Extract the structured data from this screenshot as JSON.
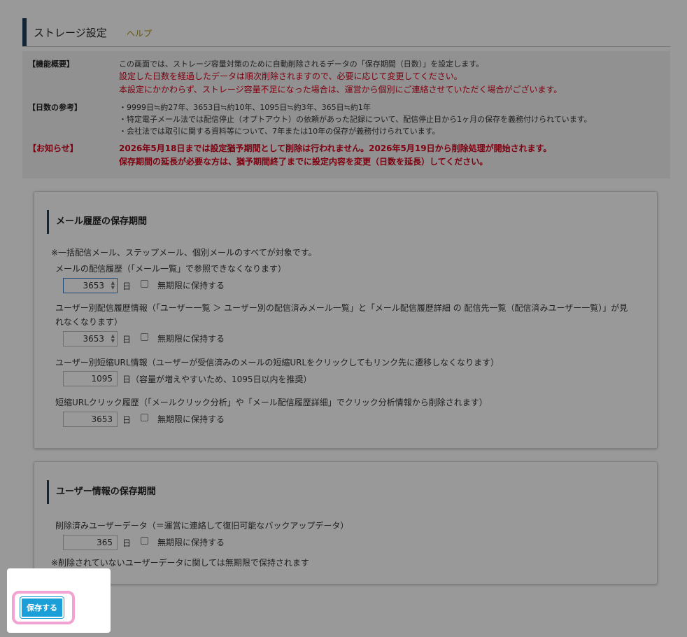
{
  "header": {
    "title": "ストレージ設定",
    "help_link": "ヘルプ"
  },
  "info": {
    "overview_label": "【機能概要】",
    "overview_lines": [
      "この画面では、ストレージ容量対策のために自動削除されるデータの「保存期間（日数）」を設定します。",
      "設定した日数を経過したデータは順次削除されますので、必要に応じて変更してください。",
      "本設定にかかわらず、ストレージ容量不足になった場合は、運営から個別にご連絡させていただく場合がございます。"
    ],
    "reference_label": "【日数の参考】",
    "reference_lines": [
      "・9999日≒約27年、3653日≒約10年、1095日≒約3年、365日≒約1年",
      "・特定電子メール法では配信停止（オプトアウト）の依頼があった記録について、配信停止日から1ヶ月の保存を義務付けられています。",
      "・会社法では取引に関する資料等について、7年または10年の保存が義務付けられています。"
    ],
    "notice_label": "【お知らせ】",
    "notice_lines": [
      "2026年5月18日までは設定猶予期間として削除は行われません。2026年5月19日から削除処理が開始されます。",
      "保存期間の延長が必要な方は、猶予期間終了までに設定内容を変更（日数を延長）してください。"
    ]
  },
  "mail_panel": {
    "title": "メール履歴の保存期間",
    "note": "※一括配信メール、ステップメール、個別メールのすべてが対象です。",
    "fields": [
      {
        "label": "メールの配信履歴（「メール一覧」で参照できなくなります）",
        "value": "3653",
        "unit": "日",
        "checkbox_label": "無期限に保持する"
      },
      {
        "label": "ユーザー別配信履歴情報（「ユーザー一覧 ＞ ユーザー別の配信済みメール一覧」と「メール配信履歴詳細 の 配信先一覧（配信済みユーザー一覧）」が見れなくなります）",
        "value": "3653",
        "unit": "日",
        "checkbox_label": "無期限に保持する"
      },
      {
        "label": "ユーザー別短縮URL情報（ユーザーが受信済みのメールの短縮URLをクリックしてもリンク先に遷移しなくなります）",
        "value": "1095",
        "unit": "日（容量が増えやすいため、1095日以内を推奨）"
      },
      {
        "label": "短縮URLクリック履歴（「メールクリック分析」や「メール配信履歴詳細」でクリック分析情報から削除されます）",
        "value": "3653",
        "unit": "日",
        "checkbox_label": "無期限に保持する"
      }
    ]
  },
  "user_panel": {
    "title": "ユーザー情報の保存期間",
    "field": {
      "label": "削除済みユーザーデータ（＝運営に連絡して復旧可能なバックアップデータ）",
      "value": "365",
      "unit": "日",
      "checkbox_label": "無期限に保持する"
    },
    "note": "※削除されていないユーザーデータに関しては無期限で保持されます"
  },
  "actions": {
    "save_label": "保存する"
  },
  "colors": {
    "accent": "#1f3f5a",
    "help": "#a88d12",
    "alert": "#d4001a",
    "button": "#1a9fd8",
    "highlight_ring": "#f2a3d2"
  }
}
